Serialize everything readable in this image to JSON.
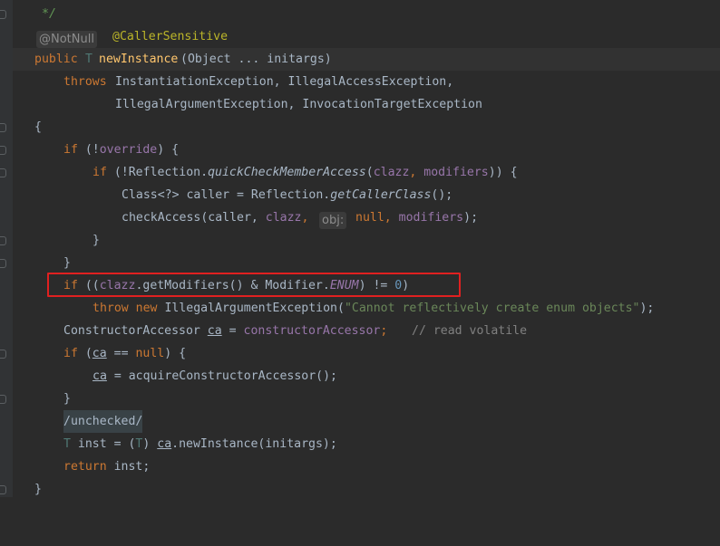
{
  "editor": {
    "javadoc_end": "*/",
    "inlay_notnull": "@NotNull",
    "ann_caller": "@CallerSensitive",
    "sig_public": "public",
    "sig_T": "T",
    "sig_name": "newInstance",
    "sig_params": "(Object ... initargs)",
    "throws_kw": "throws",
    "throws_1": "InstantiationException, IllegalAccessException,",
    "throws_2": "IllegalArgumentException, InvocationTargetException",
    "brace_open": "{",
    "if_kw": "if",
    "if_override_pre": "(!",
    "override": "override",
    "if_override_post": ") {",
    "if2_pre": "(!Reflection.",
    "quickCheck": "quickCheckMemberAccess",
    "paren_open": "(",
    "clazz": "clazz",
    "comma": ", ",
    "modifiers": "modifiers",
    "if2_post": ")) {",
    "class_decl": "Class<?> caller = Reflection.",
    "getCallerClass": "getCallerClass",
    "call_end": "();",
    "checkAccess": "checkAccess(caller, ",
    "hint_obj": "obj:",
    "null_kw": "null",
    "args_close": ");",
    "brace_close": "}",
    "enum_pre": "((",
    "enum_mid": ".getModifiers() & Modifier.",
    "ENUM": "ENUM",
    "enum_op": ") != ",
    "zero": "0",
    "enum_close": ")",
    "throw_kw": "throw",
    "new_kw": "new",
    "iae": "IllegalArgumentException(",
    "enum_msg": "\"Cannot reflectively create enum objects\"",
    "throw_end": ");",
    "ca_type": "ConstructorAccessor ",
    "ca": "ca",
    "assign": " = ",
    "constructorAccessor": "constructorAccessor",
    "semi": ";",
    "volatile_cmt": "// read volatile",
    "if_ca_pre": "(",
    "eq_null": " == ",
    "if_ca_post": ") {",
    "acquire": " = acquireConstructorAccessor();",
    "unchecked": "/unchecked/",
    "T": "T",
    "inst_decl": " inst = (",
    "cast_close": ") ",
    "newInstanceCall": ".newInstance(initargs);",
    "return_kw": "return",
    "return_val": " inst;"
  }
}
